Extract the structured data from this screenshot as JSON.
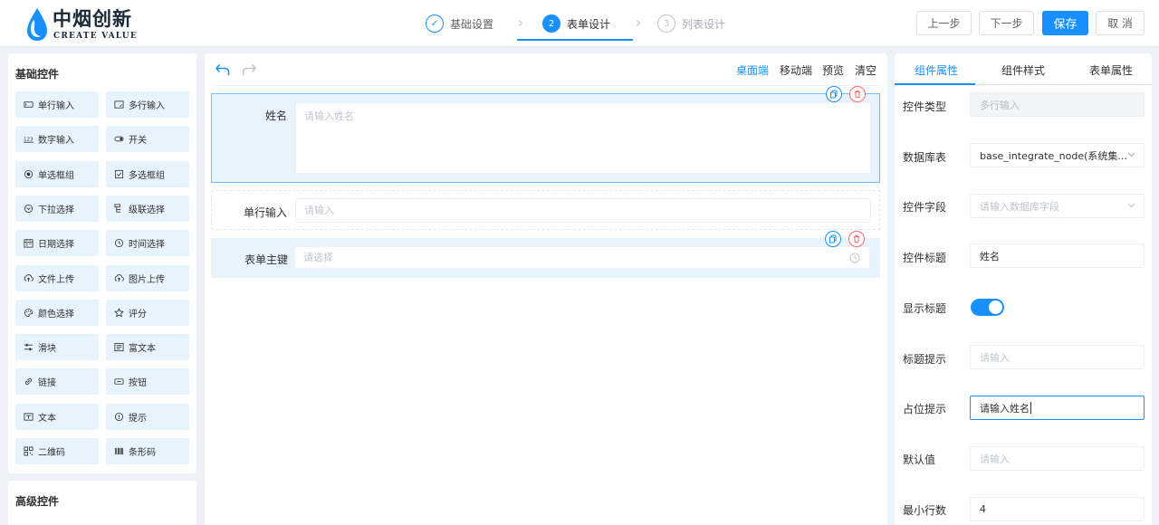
{
  "brand": {
    "name_cn": "中烟创新",
    "name_en": "CREATE VALUE"
  },
  "steps": [
    {
      "index": "✓",
      "label": "基础设置",
      "state": "done"
    },
    {
      "index": "2",
      "label": "表单设计",
      "state": "active"
    },
    {
      "index": "3",
      "label": "列表设计",
      "state": "todo"
    }
  ],
  "header_actions": {
    "prev": "上一步",
    "next": "下一步",
    "save": "保存",
    "cancel": "取 消"
  },
  "palette": {
    "basic_title": "基础控件",
    "advanced_title": "高级控件",
    "items": [
      {
        "label": "单行输入",
        "icon": "single-line-input-icon"
      },
      {
        "label": "多行输入",
        "icon": "multi-line-input-icon"
      },
      {
        "label": "数字输入",
        "icon": "number-input-icon"
      },
      {
        "label": "开关",
        "icon": "switch-icon"
      },
      {
        "label": "单选框组",
        "icon": "radio-icon"
      },
      {
        "label": "多选框组",
        "icon": "checkbox-icon"
      },
      {
        "label": "下拉选择",
        "icon": "dropdown-icon"
      },
      {
        "label": "级联选择",
        "icon": "cascader-icon"
      },
      {
        "label": "日期选择",
        "icon": "calendar-icon"
      },
      {
        "label": "时间选择",
        "icon": "clock-icon"
      },
      {
        "label": "文件上传",
        "icon": "upload-icon"
      },
      {
        "label": "图片上传",
        "icon": "image-upload-icon"
      },
      {
        "label": "颜色选择",
        "icon": "palette-icon"
      },
      {
        "label": "评分",
        "icon": "star-icon"
      },
      {
        "label": "滑块",
        "icon": "slider-icon"
      },
      {
        "label": "富文本",
        "icon": "rich-text-icon"
      },
      {
        "label": "链接",
        "icon": "link-icon"
      },
      {
        "label": "按钮",
        "icon": "button-icon"
      },
      {
        "label": "文本",
        "icon": "text-icon"
      },
      {
        "label": "提示",
        "icon": "info-icon"
      },
      {
        "label": "二维码",
        "icon": "qrcode-icon"
      },
      {
        "label": "条形码",
        "icon": "barcode-icon"
      }
    ]
  },
  "canvas": {
    "toolbar": {
      "desktop": "桌面端",
      "mobile": "移动端",
      "preview": "预览",
      "clear": "清空"
    },
    "fields": [
      {
        "label": "姓名",
        "placeholder": "请输入姓名",
        "type": "textarea",
        "state": "selected"
      },
      {
        "label": "单行输入",
        "placeholder": "请输入",
        "type": "input",
        "state": "normal"
      },
      {
        "label": "表单主键",
        "placeholder": "请选择",
        "type": "select",
        "state": "hover"
      }
    ]
  },
  "props_panel": {
    "tabs": [
      "组件属性",
      "组件样式",
      "表单属性"
    ],
    "active_tab": 0,
    "rows": [
      {
        "label": "控件类型",
        "value": "多行输入",
        "kind": "disabled"
      },
      {
        "label": "数据库表",
        "value": "base_integrate_node(系统集...",
        "kind": "select-filled"
      },
      {
        "label": "控件字段",
        "value": "请输入数据库字段",
        "kind": "select-placeholder"
      },
      {
        "label": "控件标题",
        "value": "姓名",
        "kind": "filled"
      },
      {
        "label": "显示标题",
        "value": "",
        "kind": "switch"
      },
      {
        "label": "标题提示",
        "value": "请输入",
        "kind": "placeholder"
      },
      {
        "label": "占位提示",
        "value": "请输入姓名",
        "kind": "focused"
      },
      {
        "label": "默认值",
        "value": "请输入",
        "kind": "placeholder"
      },
      {
        "label": "最小行数",
        "value": "4",
        "kind": "filled"
      }
    ],
    "show_title_enabled": true
  },
  "colors": {
    "primary": "#1890ff",
    "danger": "#f56c6c",
    "palette_item_bg": "#e8f4fd",
    "page_bg": "#eef1f6"
  }
}
